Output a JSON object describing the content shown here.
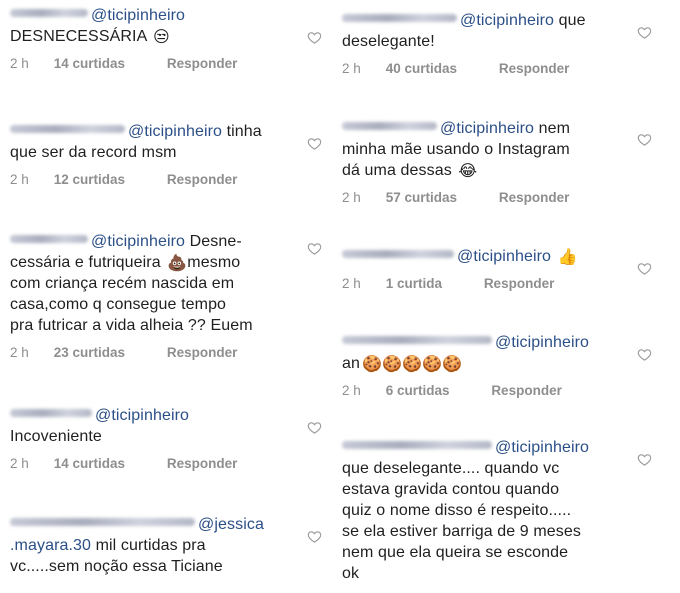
{
  "left_column": [
    {
      "mention": "@ticipinheiro",
      "text_lines": [
        "DESNECESSÁRIA"
      ],
      "emoji": "😒",
      "time": "2 h",
      "likes": "14 curtidas",
      "reply": "Responder"
    },
    {
      "mention": "@ticipinheiro",
      "first_suffix": " tinha",
      "text_lines": [
        "que ser da record msm"
      ],
      "time": "2 h",
      "likes": "12 curtidas",
      "reply": "Responder"
    },
    {
      "mention": "@ticipinheiro",
      "first_suffix": " Desne-",
      "text_lines": [
        "cessária e futriqueira",
        "com criança recém nascida em",
        "casa,como q consegue tempo",
        "pra futricar a vida alheia ?? Euem"
      ],
      "inline_emoji": "💩",
      "inline_after": "mesmo",
      "time": "2 h",
      "likes": "23 curtidas",
      "reply": "Responder"
    },
    {
      "mention": "@ticipinheiro",
      "text_lines": [
        "Incoveniente"
      ],
      "time": "2 h",
      "likes": "14 curtidas",
      "reply": "Responder"
    },
    {
      "mention": "@jessica",
      "mention_cont": ".mayara.30",
      "text_after_mention": " mil curtidas pra",
      "text_lines": [
        "vc.....sem noção essa Ticiane"
      ]
    }
  ],
  "right_column": [
    {
      "mention": "@ticipinheiro",
      "first_suffix": " que",
      "text_lines": [
        "deselegante!"
      ],
      "time": "2 h",
      "likes": "40 curtidas",
      "reply": "Responder"
    },
    {
      "mention": "@ticipinheiro",
      "first_suffix": " nem",
      "text_lines": [
        "minha mãe usando o Instagram",
        "dá uma dessas"
      ],
      "emoji": "😂",
      "time": "2 h",
      "likes": "57 curtidas",
      "reply": "Responder"
    },
    {
      "mention": "@ticipinheiro",
      "emoji": "👍",
      "time": "2 h",
      "likes": "1 curtida",
      "reply": "Responder"
    },
    {
      "mention": "@ticipinheiro",
      "text_lines": [
        "an"
      ],
      "emoji": "🍪🍪🍪🍪🍪",
      "time": "2 h",
      "likes": "6 curtidas",
      "reply": "Responder"
    },
    {
      "mention": "@ticipinheiro",
      "text_lines": [
        "que deselegante.... quando vc",
        "estava gravida contou quando",
        "quiz o nome disso é respeito.....",
        "se ela estiver barriga de 9 meses",
        "nem que ela queira se esconde",
        "ok"
      ]
    }
  ]
}
